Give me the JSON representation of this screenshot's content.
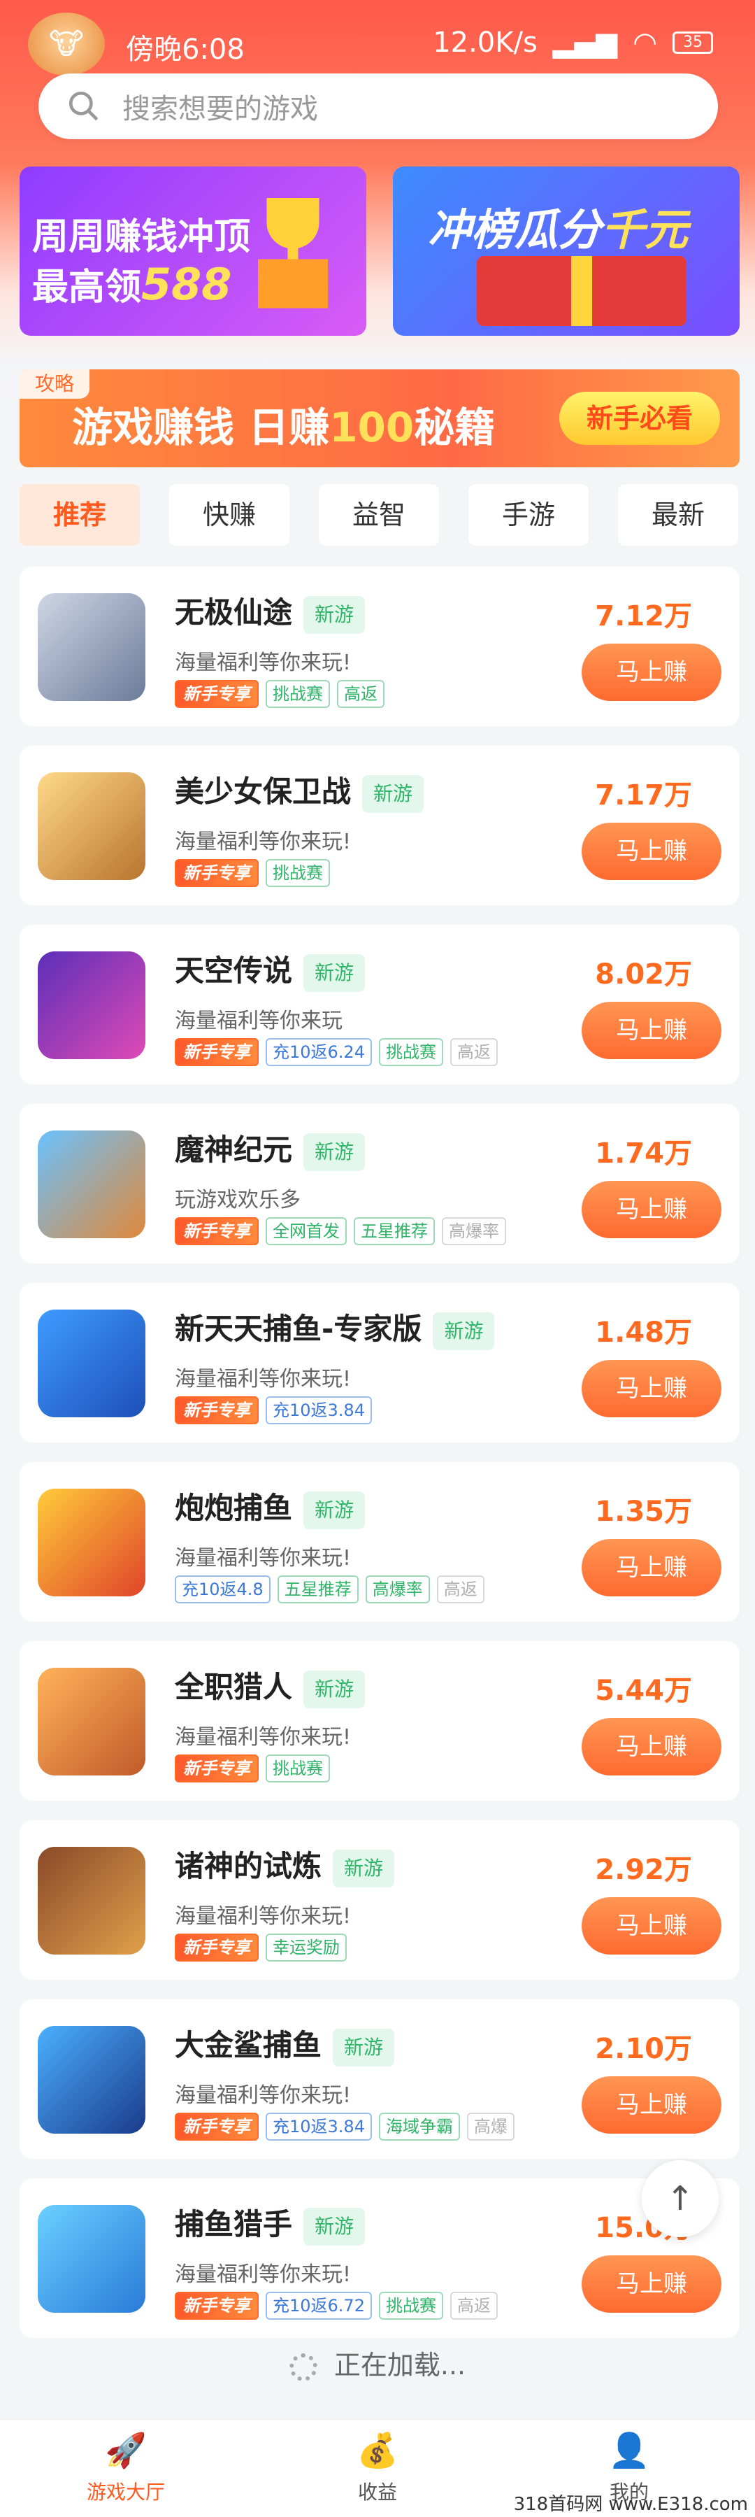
{
  "status_bar": {
    "time": "傍晚6:08",
    "speed": "12.0K/s",
    "battery": "35"
  },
  "search": {
    "placeholder": "搜索想要的游戏"
  },
  "banners": [
    {
      "line1": "周周赚钱冲顶",
      "line2_prefix": "最高领",
      "line2_num": "588"
    },
    {
      "prefix": "冲榜瓜分",
      "highlight": "千元"
    }
  ],
  "promo": {
    "tag": "攻略",
    "text_prefix": "游戏赚钱 日赚",
    "text_num": "100",
    "text_suffix": "秘籍",
    "button": "新手必看"
  },
  "tabs": [
    "推荐",
    "快赚",
    "益智",
    "手游",
    "最新"
  ],
  "new_label": "新游",
  "earn_label": "马上赚",
  "games": [
    {
      "name": "无极仙途",
      "desc": "海量福利等你来玩!",
      "amount": "7.12万",
      "tags": [
        {
          "t": "新手专享",
          "c": "x"
        },
        {
          "t": "挑战赛",
          "c": "g"
        },
        {
          "t": "高返",
          "c": "g"
        }
      ]
    },
    {
      "name": "美少女保卫战",
      "desc": "海量福利等你来玩!",
      "amount": "7.17万",
      "tags": [
        {
          "t": "新手专享",
          "c": "x"
        },
        {
          "t": "挑战赛",
          "c": "g"
        }
      ]
    },
    {
      "name": "天空传说",
      "desc": "海量福利等你来玩",
      "amount": "8.02万",
      "tags": [
        {
          "t": "新手专享",
          "c": "x"
        },
        {
          "t": "充10返6.24",
          "c": "b"
        },
        {
          "t": "挑战赛",
          "c": "g"
        },
        {
          "t": "高返",
          "c": "r"
        }
      ]
    },
    {
      "name": "魔神纪元",
      "desc": "玩游戏欢乐多",
      "amount": "1.74万",
      "tags": [
        {
          "t": "新手专享",
          "c": "x"
        },
        {
          "t": "全网首发",
          "c": "g"
        },
        {
          "t": "五星推荐",
          "c": "g"
        },
        {
          "t": "高爆率",
          "c": "r"
        }
      ]
    },
    {
      "name": "新天天捕鱼-专家版",
      "desc": "海量福利等你来玩!",
      "amount": "1.48万",
      "tags": [
        {
          "t": "新手专享",
          "c": "x"
        },
        {
          "t": "充10返3.84",
          "c": "b"
        }
      ]
    },
    {
      "name": "炮炮捕鱼",
      "desc": "海量福利等你来玩!",
      "amount": "1.35万",
      "tags": [
        {
          "t": "充10返4.8",
          "c": "b"
        },
        {
          "t": "五星推荐",
          "c": "g"
        },
        {
          "t": "高爆率",
          "c": "g"
        },
        {
          "t": "高返",
          "c": "r"
        }
      ]
    },
    {
      "name": "全职猎人",
      "desc": "海量福利等你来玩!",
      "amount": "5.44万",
      "tags": [
        {
          "t": "新手专享",
          "c": "x"
        },
        {
          "t": "挑战赛",
          "c": "g"
        }
      ]
    },
    {
      "name": "诸神的试炼",
      "desc": "海量福利等你来玩!",
      "amount": "2.92万",
      "tags": [
        {
          "t": "新手专享",
          "c": "x"
        },
        {
          "t": "幸运奖励",
          "c": "g"
        }
      ]
    },
    {
      "name": "大金鲨捕鱼",
      "desc": "海量福利等你来玩!",
      "amount": "2.10万",
      "tags": [
        {
          "t": "新手专享",
          "c": "x"
        },
        {
          "t": "充10返3.84",
          "c": "b"
        },
        {
          "t": "海域争霸",
          "c": "g"
        },
        {
          "t": "高爆",
          "c": "r"
        }
      ]
    },
    {
      "name": "捕鱼猎手",
      "desc": "海量福利等你来玩!",
      "amount": "15.0万",
      "tags": [
        {
          "t": "新手专享",
          "c": "x"
        },
        {
          "t": "充10返6.72",
          "c": "b"
        },
        {
          "t": "挑战赛",
          "c": "g"
        },
        {
          "t": "高返",
          "c": "r"
        }
      ]
    }
  ],
  "loading_text": "正在加载...",
  "bottom_nav": [
    "游戏大厅",
    "收益",
    "我的"
  ],
  "watermark": "318首码网 www.E318.com",
  "colors": {
    "accent": "#ff6a1e",
    "new_tag": "#2fb468"
  }
}
